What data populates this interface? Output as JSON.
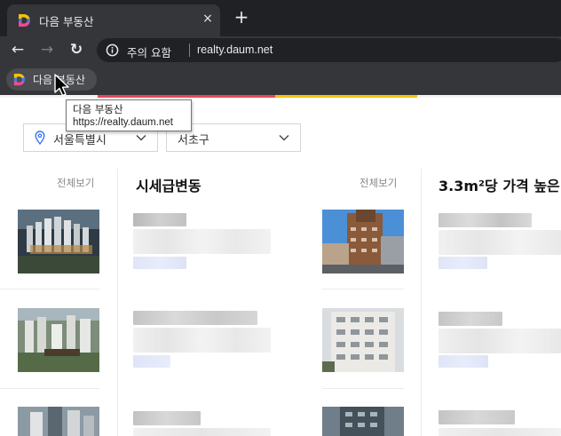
{
  "browser": {
    "tab": {
      "title": "다음 부동산",
      "close_icon": "×"
    },
    "new_tab_icon": "+",
    "nav": {
      "back_icon": "←",
      "forward_icon": "→",
      "reload_icon": "↻"
    },
    "omnibox": {
      "security_label": "주의 요함",
      "url": "realty.daum.net"
    },
    "bookmark": {
      "label": "다음 부동산"
    },
    "tooltip": {
      "title": "다음 부동산",
      "url": "https://realty.daum.net"
    }
  },
  "page": {
    "filters": {
      "city": "서울특별시",
      "district": "서초구"
    },
    "sections": [
      {
        "view_all": "전체보기"
      },
      {
        "title": "시세급변동",
        "view_all": "전체보기"
      },
      {
        "title": "3.3m²당 가격 높은"
      }
    ]
  },
  "colors": {
    "brand_yellow": "#f5c400",
    "brand_blue": "#3b7bf6",
    "brand_pink": "#ef4b8c",
    "accent": "#3b73f3"
  }
}
